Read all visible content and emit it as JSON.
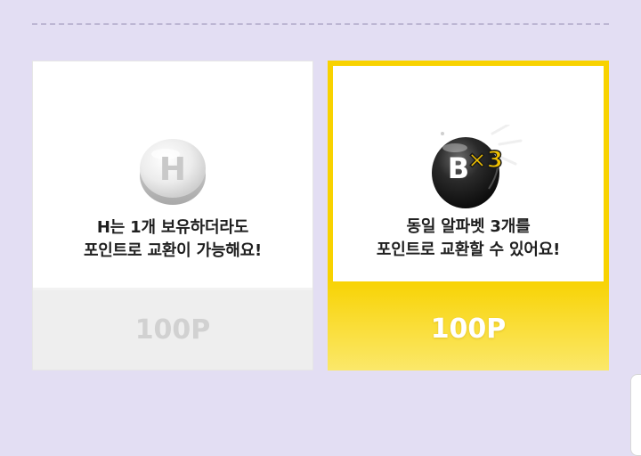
{
  "cards": [
    {
      "badge_letter": "H",
      "desc_line1": "H는 1개 보유하더라도",
      "desc_line2": "포인트로 교환이 가능해요!",
      "price": "100P",
      "state": "disabled"
    },
    {
      "badge_letter": "B",
      "badge_multiplier": "×3",
      "desc_line1": "동일 알파벳 3개를",
      "desc_line2": "포인트로 교환할 수 있어요!",
      "price": "100P",
      "state": "selected"
    }
  ],
  "colors": {
    "background": "#e3def3",
    "accent_yellow": "#f8d200",
    "disabled_price": "#d1d1d1"
  },
  "icons": {
    "left_badge": "h-letter-coin-icon",
    "right_badge": "b-letter-ball-times-three-icon"
  }
}
